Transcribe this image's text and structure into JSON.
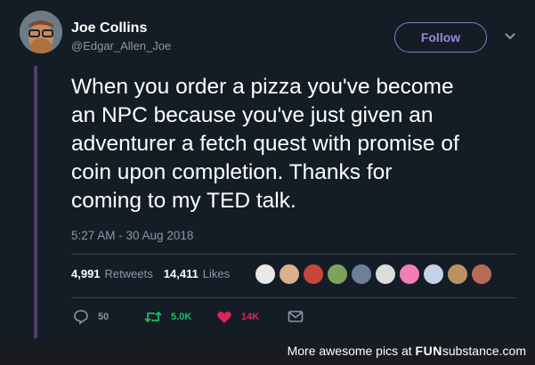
{
  "author": {
    "display_name": "Joe Collins",
    "handle": "@Edgar_Allen_Joe"
  },
  "follow_button_label": "Follow",
  "tweet_text": "When you order a pizza you've become\nan NPC because you've just given an\nadventurer a fetch quest with promise of\ncoin upon completion. Thanks for\ncoming to my TED talk.",
  "timestamp": "5:27 AM - 30 Aug 2018",
  "stats": {
    "retweets_count": "4,991",
    "retweets_label": "Retweets",
    "likes_count": "14,411",
    "likes_label": "Likes"
  },
  "actions": {
    "reply_count": "50",
    "retweet_count": "5.0K",
    "like_count": "14K"
  },
  "footer": {
    "prefix": "More awesome pics at ",
    "brand_a": "FUN",
    "brand_b": "substance",
    "brand_c": ".com"
  },
  "colors": {
    "background": "#141d26",
    "accent": "#9b86d8",
    "retweet": "#17bf63",
    "like": "#e0245e",
    "muted": "#8899a6"
  },
  "icons": [
    "chevron-down-icon",
    "reply-icon",
    "retweet-icon",
    "heart-icon",
    "message-icon"
  ]
}
